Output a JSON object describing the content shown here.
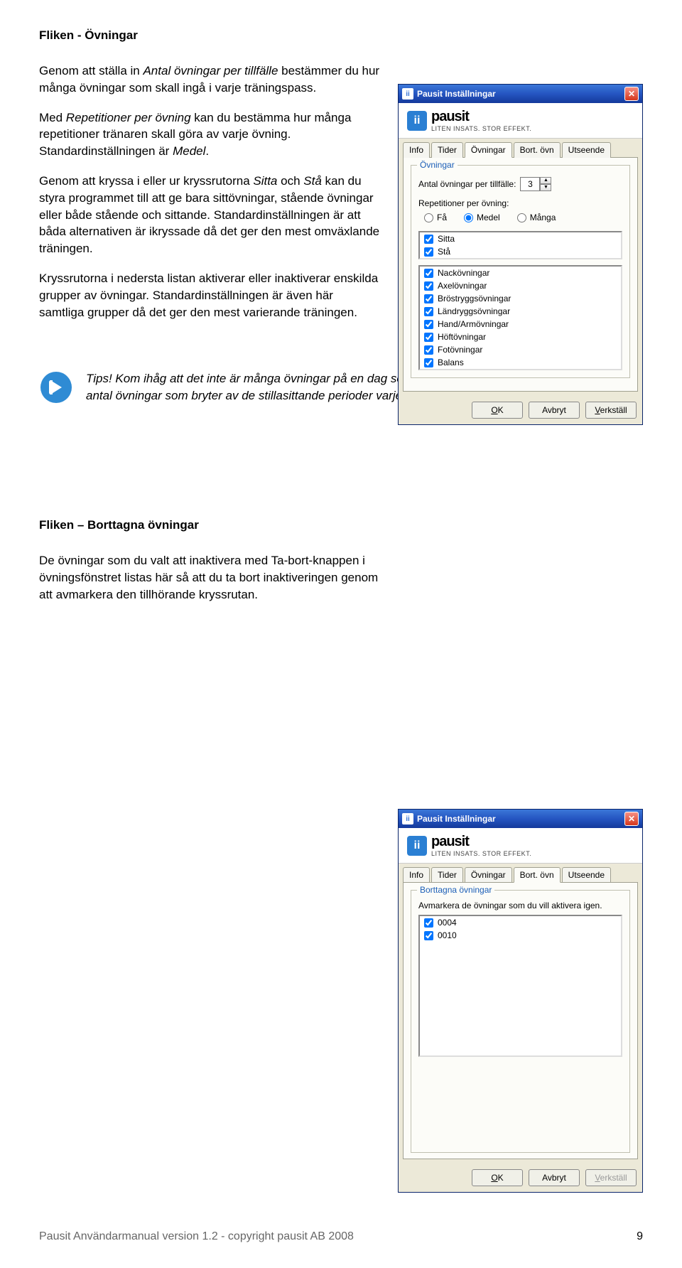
{
  "section1": {
    "heading": "Fliken - Övningar",
    "p1_a": "Genom att ställa in ",
    "p1_b": "Antal övningar per tillfälle",
    "p1_c": " bestämmer du hur många övningar som skall ingå i varje träningspass.",
    "p2_a": "Med ",
    "p2_b": "Repetitioner per övning",
    "p2_c": " kan du bestämma hur många repetitioner tränaren skall göra av varje övning. Standardinställningen är ",
    "p2_d": "Medel",
    "p2_e": ".",
    "p3_a": "Genom att kryssa i eller ur kryssrutorna ",
    "p3_b": "Sitta",
    "p3_c": " och ",
    "p3_d": "Stå",
    "p3_e": " kan du styra programmet till att ge bara sittövningar, stående övningar eller både stående och sittande. Standardinställningen är att båda alternativen är ikryssade då det ger den mest omväxlande träningen.",
    "p4": "Kryssrutorna i nedersta listan aktiverar eller inaktiverar enskilda grupper av övningar. Standardinställningen är även här samtliga grupper då det ger den mest varierande träningen."
  },
  "tip": {
    "label": "Tips!",
    "text": " Kom ihåg att det inte är många övningar på en dag som är eftersträvansvärt utan det är lagom antal övningar som bryter av de stillasittande perioder varje dag som gör mest nytta."
  },
  "section2": {
    "heading": "Fliken – Borttagna övningar",
    "p1": "De övningar som du valt att inaktivera med Ta-bort-knappen i övningsfönstret listas här så att du ta bort inaktiveringen genom att avmarkera den tillhörande kryssrutan."
  },
  "dialog1": {
    "title": "Pausit Inställningar",
    "brand": "pausit",
    "tagline": "LITEN INSATS. STOR EFFEKT.",
    "tabs": [
      "Info",
      "Tider",
      "Övningar",
      "Bort. övn",
      "Utseende"
    ],
    "active_tab": 2,
    "group_title": "Övningar",
    "field_label": "Antal övningar per tillfälle:",
    "field_value": "3",
    "rep_label": "Repetitioner per övning:",
    "radios": [
      "Få",
      "Medel",
      "Många"
    ],
    "radio_selected": 1,
    "top_checks": [
      {
        "label": "Sitta",
        "checked": true
      },
      {
        "label": "Stå",
        "checked": true
      }
    ],
    "groups": [
      {
        "label": "Nackövningar",
        "checked": true
      },
      {
        "label": "Axelövningar",
        "checked": true
      },
      {
        "label": "Bröstryggsövningar",
        "checked": true
      },
      {
        "label": "Ländryggsövningar",
        "checked": true
      },
      {
        "label": "Hand/Armövningar",
        "checked": true
      },
      {
        "label": "Höftövningar",
        "checked": true
      },
      {
        "label": "Fotövningar",
        "checked": true
      },
      {
        "label": "Balans",
        "checked": true
      }
    ],
    "buttons": {
      "ok": "OK",
      "cancel": "Avbryt",
      "apply": "Verkställ"
    }
  },
  "dialog2": {
    "title": "Pausit Inställningar",
    "brand": "pausit",
    "tagline": "LITEN INSATS. STOR EFFEKT.",
    "tabs": [
      "Info",
      "Tider",
      "Övningar",
      "Bort. övn",
      "Utseende"
    ],
    "active_tab": 3,
    "group_title": "Borttagna övningar",
    "desc": "Avmarkera de övningar som du vill aktivera igen.",
    "items": [
      {
        "label": "0004",
        "checked": true
      },
      {
        "label": "0010",
        "checked": true
      }
    ],
    "buttons": {
      "ok": "OK",
      "cancel": "Avbryt",
      "apply": "Verkställ"
    }
  },
  "footer": {
    "left": "Pausit Användarmanual version 1.2  - copyright pausit AB 2008",
    "right": "9"
  }
}
